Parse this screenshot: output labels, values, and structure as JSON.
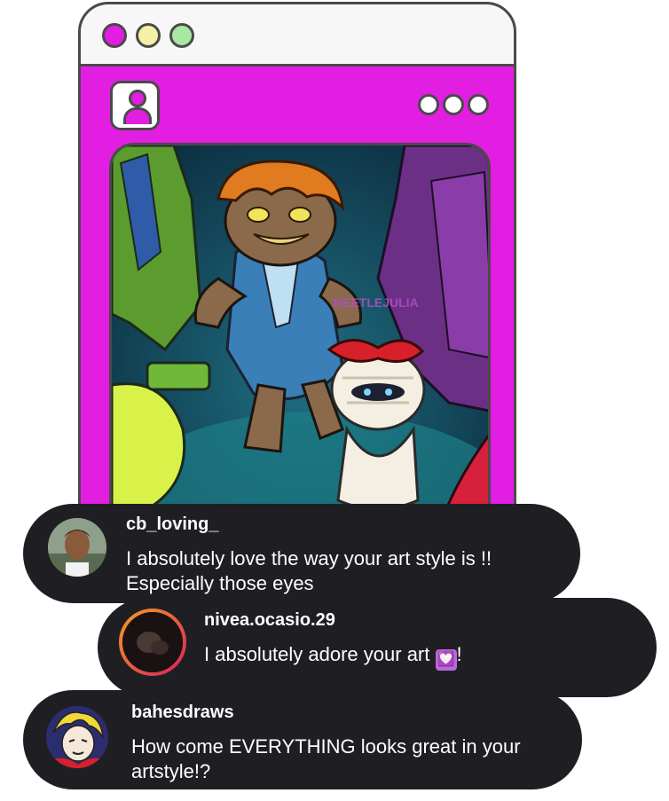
{
  "window": {
    "traffic_lights": [
      "#e21ee2",
      "#f6f0a6",
      "#a7e8a2"
    ],
    "accent_color": "#e21ee2",
    "profile_icon": "user-icon",
    "more_icon": "more-dots-icon"
  },
  "artwork": {
    "watermark": "BEETLEJULIA"
  },
  "comments": [
    {
      "username": "cb_loving_",
      "text": "I absolutely love the way your art style is !! Especially those eyes"
    },
    {
      "username": "nivea.ocasio.29",
      "text": "I absolutely adore your art",
      "emoji": "💟",
      "suffix": "!"
    },
    {
      "username": "bahesdraws",
      "text": "How come EVERYTHING looks great in your artstyle!?"
    }
  ]
}
